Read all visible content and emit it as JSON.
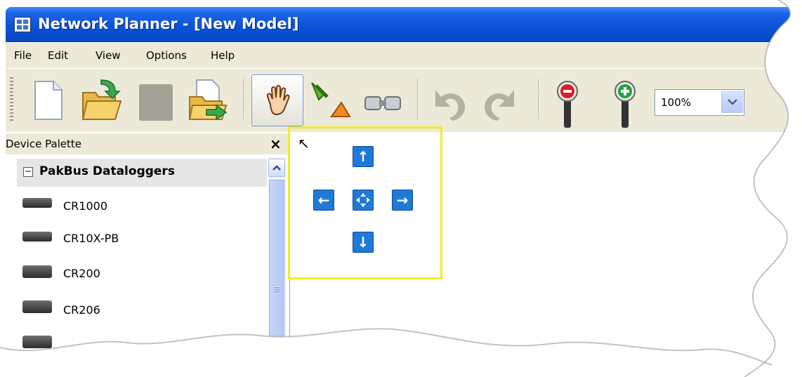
{
  "window": {
    "title": "Network Planner - [New Model]"
  },
  "menu": {
    "items": [
      "File",
      "Edit",
      "View",
      "Options",
      "Help"
    ]
  },
  "toolbar": {
    "buttons": [
      {
        "name": "new-model",
        "icon": "new-file-icon"
      },
      {
        "name": "open-model",
        "icon": "open-folder-icon"
      },
      {
        "name": "save-model",
        "icon": "save-disabled-icon"
      },
      {
        "name": "export",
        "icon": "export-folder-icon"
      },
      {
        "name": "pan",
        "icon": "hand-icon"
      },
      {
        "name": "add-link",
        "icon": "plug-icon"
      },
      {
        "name": "connect",
        "icon": "connector-icon"
      },
      {
        "name": "undo",
        "icon": "undo-icon"
      },
      {
        "name": "redo",
        "icon": "redo-icon"
      },
      {
        "name": "zoom-out",
        "icon": "zoom-out-icon"
      },
      {
        "name": "zoom-in",
        "icon": "zoom-in-icon"
      }
    ],
    "zoom_value": "100%"
  },
  "palette": {
    "title": "Device Palette",
    "group": "PakBus Dataloggers",
    "devices": [
      "CR1000",
      "CR10X-PB",
      "CR200",
      "CR206"
    ]
  },
  "colors": {
    "titlebar": "#0a53d9",
    "highlight": "#f2ee22",
    "pan_button": "#1e7ad6",
    "chrome": "#ece9d8"
  }
}
